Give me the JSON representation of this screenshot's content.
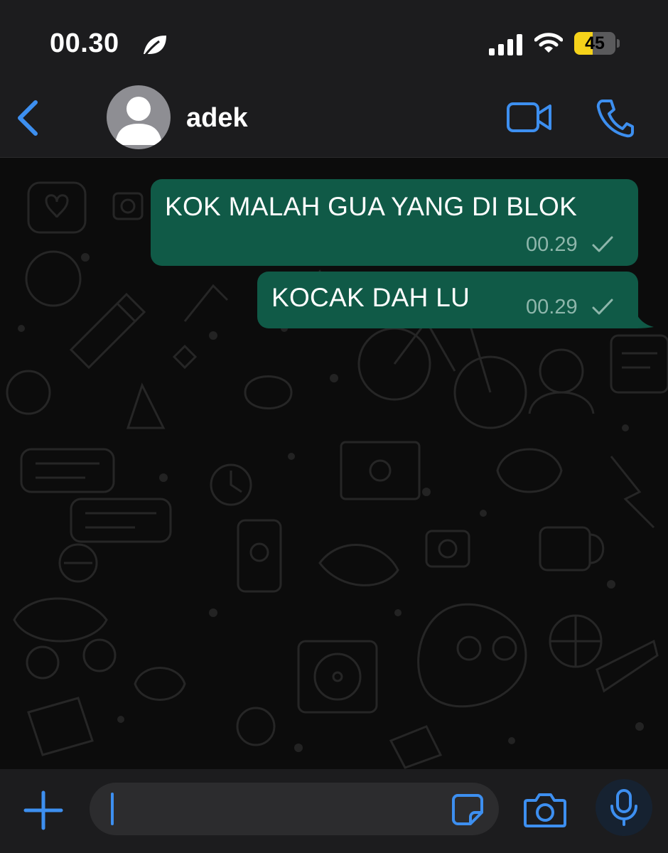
{
  "status_bar": {
    "time": "00.30",
    "battery_level": "45",
    "battery_fraction": 0.45,
    "battery_color": "#f5d21a",
    "icons": [
      "leaf-icon",
      "signal-bars-icon",
      "wifi-icon",
      "battery-icon"
    ]
  },
  "header": {
    "contact_name": "adek",
    "icons": [
      "back-chevron-icon",
      "avatar-placeholder-icon",
      "video-call-icon",
      "voice-call-icon"
    ]
  },
  "messages": [
    {
      "text": "KOK MALAH GUA YANG DI BLOK",
      "time": "00.29",
      "status": "sent-single-check"
    },
    {
      "text": "KOCAK DAH LU",
      "time": "00.29",
      "status": "sent-single-check"
    }
  ],
  "input_bar": {
    "value": "",
    "icons": [
      "plus-icon",
      "sticker-icon",
      "camera-icon",
      "microphone-icon"
    ]
  },
  "colors": {
    "accent": "#3d8ff0",
    "outgoing_bubble": "#105a47",
    "bar_background": "#1c1c1e",
    "chat_background": "#0c0c0c"
  }
}
